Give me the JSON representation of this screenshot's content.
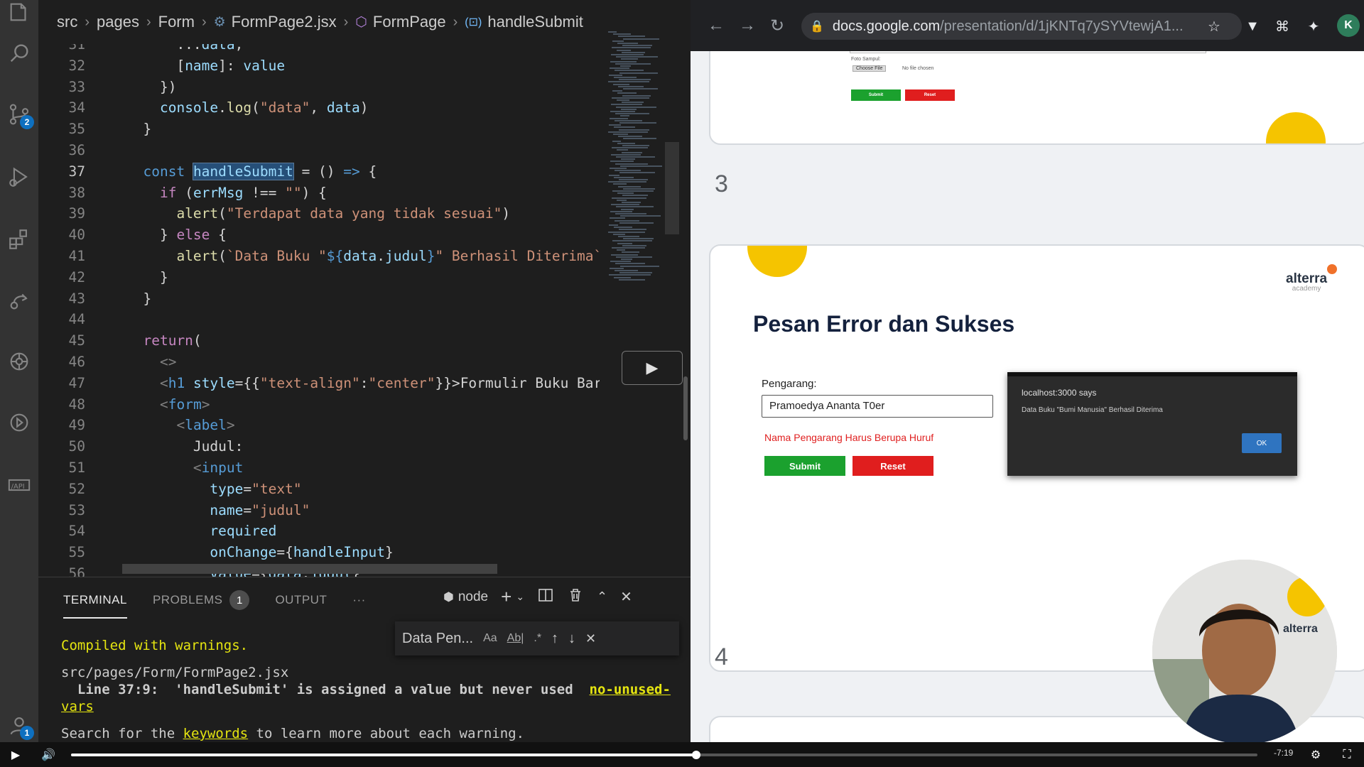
{
  "breadcrumb": {
    "items": [
      "src",
      "pages",
      "Form",
      "FormPage2.jsx",
      "FormPage",
      "handleSubmit"
    ]
  },
  "editor": {
    "lines": [
      {
        "n": "31",
        "tokens": [
          [
            "plain",
            "      ..."
          ],
          [
            "var",
            "data"
          ],
          [
            "plain",
            ","
          ]
        ]
      },
      {
        "n": "32",
        "tokens": [
          [
            "plain",
            "      ["
          ],
          [
            "var",
            "name"
          ],
          [
            "plain",
            "]: "
          ],
          [
            "var",
            "value"
          ]
        ]
      },
      {
        "n": "33",
        "tokens": [
          [
            "plain",
            "    })"
          ]
        ]
      },
      {
        "n": "34",
        "tokens": [
          [
            "plain",
            "    "
          ],
          [
            "var",
            "console"
          ],
          [
            "plain",
            "."
          ],
          [
            "fn",
            "log"
          ],
          [
            "plain",
            "("
          ],
          [
            "str",
            "\"data\""
          ],
          [
            "plain",
            ", "
          ],
          [
            "var",
            "data"
          ],
          [
            "plain",
            ")"
          ]
        ]
      },
      {
        "n": "35",
        "tokens": [
          [
            "plain",
            "  }"
          ]
        ]
      },
      {
        "n": "36",
        "tokens": []
      },
      {
        "n": "37",
        "tokens": [
          [
            "plain",
            "  "
          ],
          [
            "kw",
            "const"
          ],
          [
            "plain",
            " "
          ],
          [
            "hl",
            "handleSubmit"
          ],
          [
            "plain",
            " = () "
          ],
          [
            "kw",
            "=>"
          ],
          [
            "plain",
            " {"
          ]
        ]
      },
      {
        "n": "38",
        "tokens": [
          [
            "plain",
            "    "
          ],
          [
            "ctl",
            "if"
          ],
          [
            "plain",
            " ("
          ],
          [
            "var",
            "errMsg"
          ],
          [
            "plain",
            " !== "
          ],
          [
            "str",
            "\"\""
          ],
          [
            "plain",
            ") {"
          ]
        ]
      },
      {
        "n": "39",
        "tokens": [
          [
            "plain",
            "      "
          ],
          [
            "fn",
            "alert"
          ],
          [
            "plain",
            "("
          ],
          [
            "str",
            "\"Terdapat data yang tidak sesuai\""
          ],
          [
            "plain",
            ")"
          ]
        ]
      },
      {
        "n": "40",
        "tokens": [
          [
            "plain",
            "    } "
          ],
          [
            "ctl",
            "else"
          ],
          [
            "plain",
            " {"
          ]
        ]
      },
      {
        "n": "41",
        "tokens": [
          [
            "plain",
            "      "
          ],
          [
            "fn",
            "alert"
          ],
          [
            "plain",
            "("
          ],
          [
            "str",
            "`Data Buku \""
          ],
          [
            "kw",
            "${"
          ],
          [
            "var",
            "data"
          ],
          [
            "plain",
            "."
          ],
          [
            "var",
            "judul"
          ],
          [
            "kw",
            "}"
          ],
          [
            "str",
            "\" Berhasil Diterima`"
          ],
          [
            "plain",
            ")"
          ]
        ]
      },
      {
        "n": "42",
        "tokens": [
          [
            "plain",
            "    }"
          ]
        ]
      },
      {
        "n": "43",
        "tokens": [
          [
            "plain",
            "  }"
          ]
        ]
      },
      {
        "n": "44",
        "tokens": []
      },
      {
        "n": "45",
        "tokens": [
          [
            "plain",
            "  "
          ],
          [
            "ctl",
            "return"
          ],
          [
            "plain",
            "("
          ]
        ]
      },
      {
        "n": "46",
        "tokens": [
          [
            "plain",
            "    "
          ],
          [
            "tag",
            "<>"
          ]
        ]
      },
      {
        "n": "47",
        "tokens": [
          [
            "plain",
            "    "
          ],
          [
            "tag",
            "<"
          ],
          [
            "tagn",
            "h1"
          ],
          [
            "plain",
            " "
          ],
          [
            "attr",
            "style"
          ],
          [
            "plain",
            "={{"
          ],
          [
            "str",
            "\"text-align\""
          ],
          [
            "plain",
            ":"
          ],
          [
            "str",
            "\"center\""
          ],
          [
            "plain",
            "}}>"
          ],
          [
            "plain",
            "Formulir Buku Baru"
          ]
        ]
      },
      {
        "n": "48",
        "tokens": [
          [
            "plain",
            "    "
          ],
          [
            "tag",
            "<"
          ],
          [
            "tagn",
            "form"
          ],
          [
            "tag",
            ">"
          ]
        ]
      },
      {
        "n": "49",
        "tokens": [
          [
            "plain",
            "      "
          ],
          [
            "tag",
            "<"
          ],
          [
            "tagn",
            "label"
          ],
          [
            "tag",
            ">"
          ]
        ]
      },
      {
        "n": "50",
        "tokens": [
          [
            "plain",
            "        Judul:"
          ]
        ]
      },
      {
        "n": "51",
        "tokens": [
          [
            "plain",
            "        "
          ],
          [
            "tag",
            "<"
          ],
          [
            "tagn",
            "input"
          ]
        ]
      },
      {
        "n": "52",
        "tokens": [
          [
            "plain",
            "          "
          ],
          [
            "attr",
            "type"
          ],
          [
            "plain",
            "="
          ],
          [
            "str",
            "\"text\""
          ]
        ]
      },
      {
        "n": "53",
        "tokens": [
          [
            "plain",
            "          "
          ],
          [
            "attr",
            "name"
          ],
          [
            "plain",
            "="
          ],
          [
            "str",
            "\"judul\""
          ]
        ]
      },
      {
        "n": "54",
        "tokens": [
          [
            "plain",
            "          "
          ],
          [
            "attr",
            "required"
          ]
        ]
      },
      {
        "n": "55",
        "tokens": [
          [
            "plain",
            "          "
          ],
          [
            "attr",
            "onChange"
          ],
          [
            "plain",
            "={"
          ],
          [
            "var",
            "handleInput"
          ],
          [
            "plain",
            "}"
          ]
        ]
      },
      {
        "n": "56",
        "tokens": [
          [
            "plain",
            "          "
          ],
          [
            "attr",
            "value"
          ],
          [
            "plain",
            "={"
          ],
          [
            "var",
            "data"
          ],
          [
            "plain",
            "."
          ],
          [
            "var",
            "judul"
          ],
          [
            "plain",
            "}"
          ]
        ]
      }
    ],
    "active_line": "37"
  },
  "panel": {
    "tabs": [
      {
        "label": "TERMINAL",
        "active": true
      },
      {
        "label": "PROBLEMS",
        "badge": "1"
      },
      {
        "label": "OUTPUT"
      }
    ],
    "more": "···",
    "shell": "node",
    "find_value": "Data Pen...",
    "find_opts": [
      "Aa",
      "Ab|",
      ".*"
    ],
    "terminal": {
      "compiled": "Compiled with warnings.",
      "file": "src/pages/Form/FormPage2.jsx",
      "warning": "  Line 37:9:  'handleSubmit' is assigned a value but never used  ",
      "rule_a": "no-unused-",
      "rule_b": "vars",
      "last_a": "Search for the ",
      "last_b": "keywords",
      "last_c": " to learn more about each warning."
    }
  },
  "activity": {
    "scm_badge": "2",
    "accounts_badge": "1"
  },
  "browser": {
    "url_domain": "docs.google.com",
    "url_path": "/presentation/d/1jKNTq7ySYVtewjA1...",
    "profile": "K"
  },
  "slides": {
    "prev": {
      "label_foto": "Foto Sampul:",
      "choose_file": "Choose File",
      "no_file": "No file chosen",
      "submit": "Submit",
      "reset": "Reset"
    },
    "s3": {
      "number": "3",
      "title": "Pesan Error dan Sukses",
      "pengarang_label": "Pengarang:",
      "pengarang_value": "Pramoedya Ananta T0er",
      "error": "Nama Pengarang Harus Berupa Huruf",
      "submit": "Submit",
      "reset": "Reset",
      "dialog_title": "localhost:3000 says",
      "dialog_msg": "Data Buku \"Bumi Manusia\" Berhasil Diterima",
      "dialog_ok": "OK",
      "logo": "alterra",
      "logo_sub": "academy"
    },
    "s4": {
      "number": "4"
    }
  },
  "video": {
    "time_left": "-7:19",
    "progress": 0.527
  },
  "colors": {
    "accent_blue": "#0e70c0",
    "submit_green": "#1ba12e",
    "reset_red": "#e01e1e",
    "error_red": "#e02020",
    "slide_yellow": "#f5c400",
    "alterra_orange": "#f0712a"
  }
}
